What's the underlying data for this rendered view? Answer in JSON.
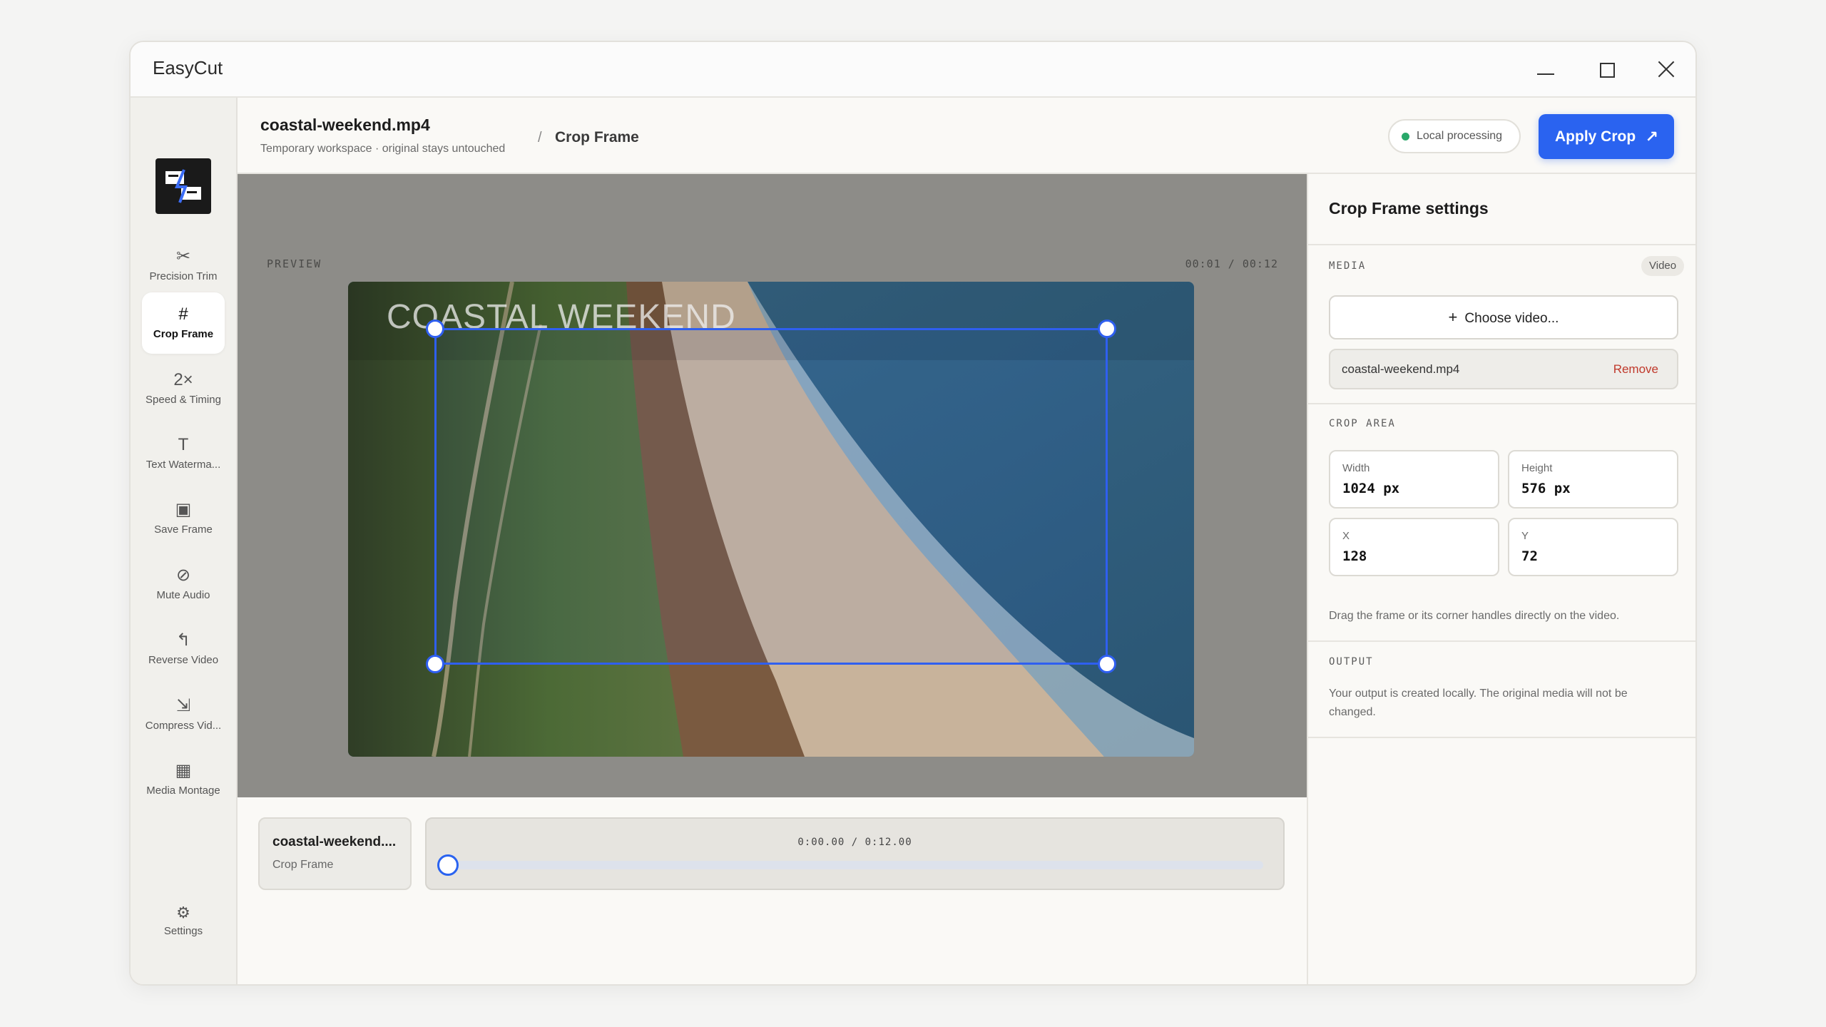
{
  "window": {
    "title": "EasyCut"
  },
  "sidebar": {
    "items": [
      {
        "label": "Precision Trim",
        "icon": "✂",
        "icon_name": "scissors-icon",
        "active": false
      },
      {
        "label": "Crop Frame",
        "icon": "#",
        "icon_name": "crop-icon",
        "active": true
      },
      {
        "label": "Speed & Timing",
        "icon": "2×",
        "icon_name": "speed-icon",
        "active": false
      },
      {
        "label": "Text Waterma...",
        "icon": "T",
        "icon_name": "text-icon",
        "active": false
      },
      {
        "label": "Save Frame",
        "icon": "▣",
        "icon_name": "save-frame-icon",
        "active": false
      },
      {
        "label": "Mute Audio",
        "icon": "⊘",
        "icon_name": "mute-icon",
        "active": false
      },
      {
        "label": "Reverse Video",
        "icon": "↰",
        "icon_name": "reverse-icon",
        "active": false
      },
      {
        "label": "Compress Vid...",
        "icon": "⇲",
        "icon_name": "compress-icon",
        "active": false
      },
      {
        "label": "Media Montage",
        "icon": "▦",
        "icon_name": "montage-icon",
        "active": false
      }
    ],
    "settings": {
      "label": "Settings",
      "icon": "⚙"
    }
  },
  "header": {
    "file_title": "coastal-weekend.mp4",
    "file_subtitle": "Temporary workspace · original stays untouched",
    "breadcrumb_sep": "/",
    "current_page": "Crop Frame",
    "status": "Local processing",
    "apply_label": "Apply Crop",
    "apply_icon": "↗"
  },
  "preview": {
    "label": "PREVIEW",
    "time": "00:01 / 00:12",
    "video_title": "COASTAL WEEKEND"
  },
  "timeline": {
    "clip_name": "coastal-weekend....",
    "clip_mode": "Crop Frame",
    "time": "0:00.00 / 0:12.00",
    "progress": 0
  },
  "panel": {
    "title": "Crop Frame settings",
    "media_label": "MEDIA",
    "media_badge": "Video",
    "choose_icon": "+",
    "choose_label": "Choose video...",
    "file_name": "coastal-weekend.mp4",
    "remove_label": "Remove",
    "crop_label": "CROP AREA",
    "fields": {
      "width": {
        "label": "Width",
        "value": "1024 px"
      },
      "height": {
        "label": "Height",
        "value": "576 px"
      },
      "x": {
        "label": "X",
        "value": "128"
      },
      "y": {
        "label": "Y",
        "value": "72"
      }
    },
    "hint": "Drag the frame or its corner handles directly on the video.",
    "output_label": "OUTPUT",
    "output_text": "Your output is created locally. The original media will not be changed."
  },
  "colors": {
    "accent": "#2a63f0",
    "status_ok": "#29a86a",
    "danger": "#c0392b"
  }
}
